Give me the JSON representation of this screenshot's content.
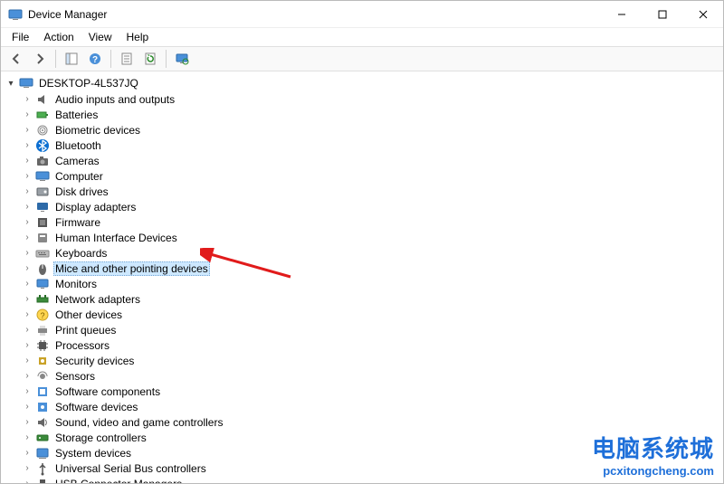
{
  "window": {
    "title": "Device Manager"
  },
  "menu": {
    "items": [
      "File",
      "Action",
      "View",
      "Help"
    ]
  },
  "toolbar": {
    "buttons": [
      {
        "name": "back-button",
        "icon": "arrow-left-icon"
      },
      {
        "name": "forward-button",
        "icon": "arrow-right-icon"
      },
      {
        "name": "show-hide-tree-button",
        "icon": "tree-pane-icon"
      },
      {
        "name": "help-button",
        "icon": "help-icon"
      },
      {
        "name": "properties-button",
        "icon": "properties-icon"
      },
      {
        "name": "refresh-button",
        "icon": "refresh-icon"
      },
      {
        "name": "scan-hardware-button",
        "icon": "monitor-scan-icon"
      }
    ]
  },
  "tree": {
    "root": {
      "label": "DESKTOP-4L537JQ",
      "icon": "computer-icon",
      "expanded": true
    },
    "items": [
      {
        "label": "Audio inputs and outputs",
        "icon": "audio-icon",
        "selected": false
      },
      {
        "label": "Batteries",
        "icon": "battery-icon",
        "selected": false
      },
      {
        "label": "Biometric devices",
        "icon": "fingerprint-icon",
        "selected": false
      },
      {
        "label": "Bluetooth",
        "icon": "bluetooth-icon",
        "selected": false
      },
      {
        "label": "Cameras",
        "icon": "camera-icon",
        "selected": false
      },
      {
        "label": "Computer",
        "icon": "computer-icon",
        "selected": false
      },
      {
        "label": "Disk drives",
        "icon": "disk-icon",
        "selected": false
      },
      {
        "label": "Display adapters",
        "icon": "display-icon",
        "selected": false
      },
      {
        "label": "Firmware",
        "icon": "firmware-icon",
        "selected": false
      },
      {
        "label": "Human Interface Devices",
        "icon": "hid-icon",
        "selected": false
      },
      {
        "label": "Keyboards",
        "icon": "keyboard-icon",
        "selected": false
      },
      {
        "label": "Mice and other pointing devices",
        "icon": "mouse-icon",
        "selected": true
      },
      {
        "label": "Monitors",
        "icon": "monitor-icon",
        "selected": false
      },
      {
        "label": "Network adapters",
        "icon": "network-icon",
        "selected": false
      },
      {
        "label": "Other devices",
        "icon": "other-icon",
        "selected": false
      },
      {
        "label": "Print queues",
        "icon": "printer-icon",
        "selected": false
      },
      {
        "label": "Processors",
        "icon": "processor-icon",
        "selected": false
      },
      {
        "label": "Security devices",
        "icon": "security-icon",
        "selected": false
      },
      {
        "label": "Sensors",
        "icon": "sensor-icon",
        "selected": false
      },
      {
        "label": "Software components",
        "icon": "software-icon",
        "selected": false
      },
      {
        "label": "Software devices",
        "icon": "software-device-icon",
        "selected": false
      },
      {
        "label": "Sound, video and game controllers",
        "icon": "sound-icon",
        "selected": false
      },
      {
        "label": "Storage controllers",
        "icon": "storage-icon",
        "selected": false
      },
      {
        "label": "System devices",
        "icon": "system-icon",
        "selected": false
      },
      {
        "label": "Universal Serial Bus controllers",
        "icon": "usb-icon",
        "selected": false
      },
      {
        "label": "USB Connector Managers",
        "icon": "usb-connector-icon",
        "selected": false
      }
    ]
  },
  "annotation": {
    "arrow_color": "#e11b1b"
  },
  "watermark": {
    "text_cn": "电脑系统城",
    "text_url": "pcxitongcheng.com"
  }
}
